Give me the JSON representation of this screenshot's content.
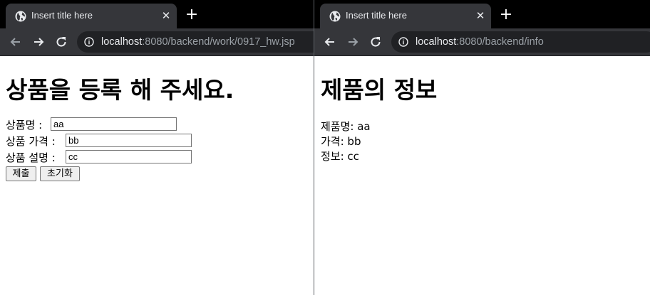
{
  "left_window": {
    "tab": {
      "title": "Insert title here",
      "close_symbol": "✕",
      "icon": "globe-icon"
    },
    "new_tab_symbol": "+",
    "url": {
      "host": "localhost",
      "rest": ":8080/backend/work/0917_hw.jsp"
    },
    "page": {
      "heading": "상품을 등록 해 주세요.",
      "fields": [
        {
          "label": "상품명 :",
          "value": "aa"
        },
        {
          "label": "상품 가격 :",
          "value": "bb"
        },
        {
          "label": "상품 설명 :",
          "value": "cc"
        }
      ],
      "submit_label": "제출",
      "reset_label": "초기화"
    }
  },
  "right_window": {
    "tab": {
      "title": "Insert title here",
      "close_symbol": "✕",
      "icon": "globe-icon"
    },
    "new_tab_symbol": "+",
    "url": {
      "host": "localhost",
      "rest": ":8080/backend/info"
    },
    "page": {
      "heading": "제품의 정보",
      "lines": [
        "제품명: aa",
        "가격: bb",
        "정보: cc"
      ]
    }
  },
  "colors": {
    "tabstrip": "#000000",
    "tab_active": "#35363a",
    "toolbar": "#35363a",
    "omnibox": "#202124",
    "url_host": "#e8eaed",
    "url_rest": "#9aa0a6"
  }
}
